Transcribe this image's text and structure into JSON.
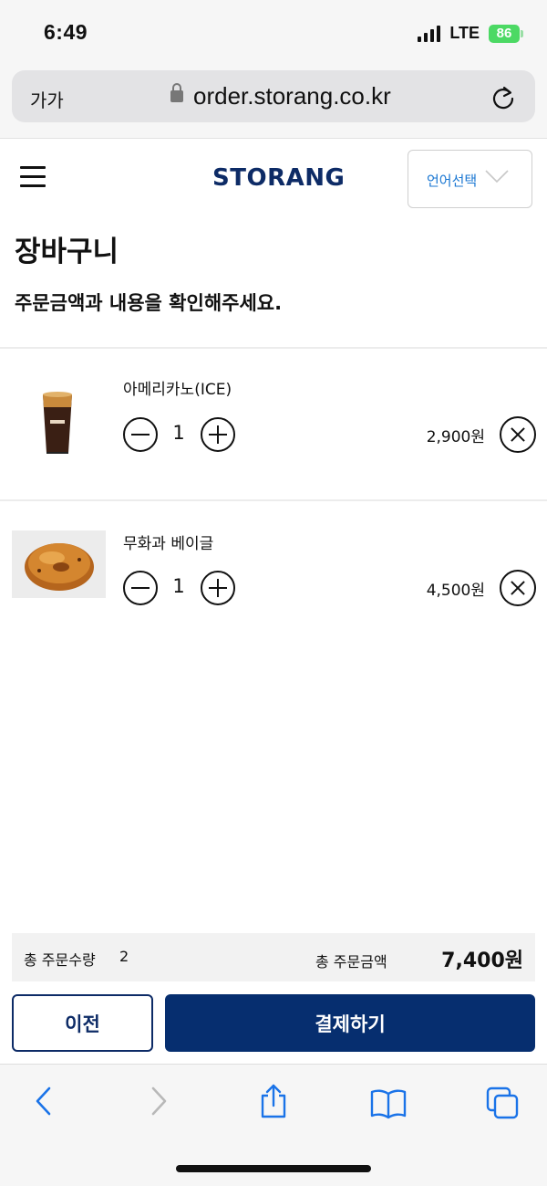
{
  "status": {
    "time": "6:49",
    "network": "LTE",
    "battery": "86"
  },
  "browser": {
    "text_size_label": "가가",
    "url": "order.storang.co.kr"
  },
  "header": {
    "logo": "STORANG",
    "language_select": "언어선택"
  },
  "page": {
    "title": "장바구니",
    "subtitle": "주문금액과 내용을 확인해주세요."
  },
  "cart": {
    "items": [
      {
        "name": "아메리카노(ICE)",
        "quantity": "1",
        "price": "2,900원",
        "image": "iced-americano-image"
      },
      {
        "name": "무화과 베이글",
        "quantity": "1",
        "price": "4,500원",
        "image": "fig-bagel-image"
      }
    ]
  },
  "summary": {
    "quantity_label": "총 주문수량",
    "quantity_value": "2",
    "amount_label": "총 주문금액",
    "amount_value": "7,400원"
  },
  "actions": {
    "prev": "이전",
    "pay": "결제하기"
  },
  "colors": {
    "brand_navy": "#062e6f",
    "link_blue": "#1976d2",
    "safari_blue": "#1a73e8"
  },
  "toolbar_icons": [
    "back-icon",
    "forward-icon",
    "share-icon",
    "bookmarks-icon",
    "tabs-icon"
  ]
}
